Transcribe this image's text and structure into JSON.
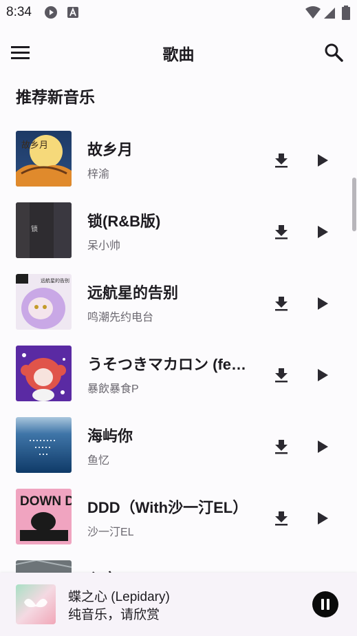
{
  "status_bar": {
    "time": "8:34",
    "icons": [
      "play-circle-icon",
      "font-a-icon",
      "wifi-icon",
      "signal-icon",
      "battery-icon"
    ]
  },
  "app_bar": {
    "title": "歌曲",
    "menu_icon": "menu-icon",
    "search_icon": "search-icon"
  },
  "section": {
    "title": "推荐新音乐"
  },
  "songs": [
    {
      "title": "故乡月",
      "artist": "梓渝"
    },
    {
      "title": "锁(R&B版)",
      "artist": "呆小帅"
    },
    {
      "title": "远航星的告别",
      "artist": "鸣潮先约电台"
    },
    {
      "title": "うそつきマカロン (feat. ...",
      "artist": "暴飲暴食P"
    },
    {
      "title": "海屿你",
      "artist": "鱼忆"
    },
    {
      "title": "DDD（With沙一汀EL）",
      "artist": "沙一汀EL"
    },
    {
      "title": "心夜",
      "artist": ""
    }
  ],
  "cover_texts": {
    "song1": "故乡月",
    "song2": "锁",
    "song3": "远航星的告别",
    "song6": "DOWN DOWN"
  },
  "now_playing": {
    "title": "蝶之心 (Lepidary)",
    "subtitle": "纯音乐，请欣赏"
  },
  "colors": {
    "background": "#fcfbfd",
    "player_bar": "#f7f3f9",
    "text_primary": "#1d1b20",
    "text_secondary": "#6b6870"
  }
}
